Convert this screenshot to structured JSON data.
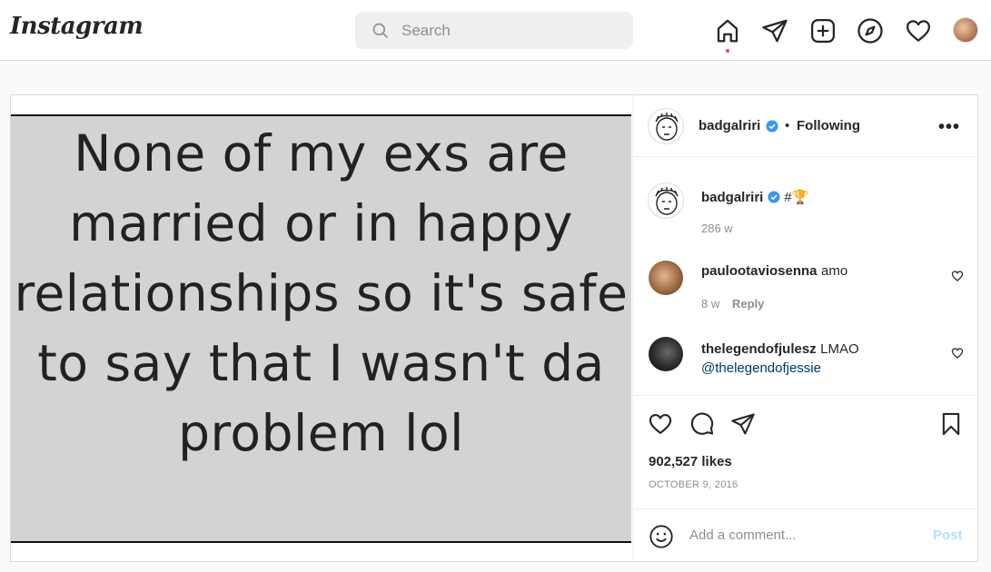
{
  "topbar": {
    "logo": "Instagram",
    "search_placeholder": "Search",
    "icons": [
      "home-icon",
      "direct-send-icon",
      "new-post-icon",
      "explore-icon",
      "activity-heart-icon",
      "profile-avatar"
    ]
  },
  "post": {
    "image_text": "None of my exs are married or in happy relationships so it's safe to say that I wasn't da problem lol",
    "header": {
      "username": "badgalriri",
      "separator": "•",
      "follow_status": "Following",
      "more": "•••"
    },
    "caption": {
      "username": "badgalriri",
      "text": "#🏆",
      "time": "286 w"
    },
    "comments": [
      {
        "username": "paulootaviosenna",
        "text": "amo",
        "time": "8 w",
        "reply": "Reply"
      },
      {
        "username": "thelegendofjulesz",
        "text": "LMAO",
        "mention": "@thelegendofjessie"
      }
    ],
    "likes": "902,527 likes",
    "date": "OCTOBER 9, 2016",
    "add_comment_placeholder": "Add a comment...",
    "post_button": "Post"
  },
  "colors": {
    "verified": "#3897f0",
    "link": "#00376b",
    "muted": "#8e8e8e",
    "post_button": "#b2dffc",
    "notification_dot": "#ed4956"
  }
}
